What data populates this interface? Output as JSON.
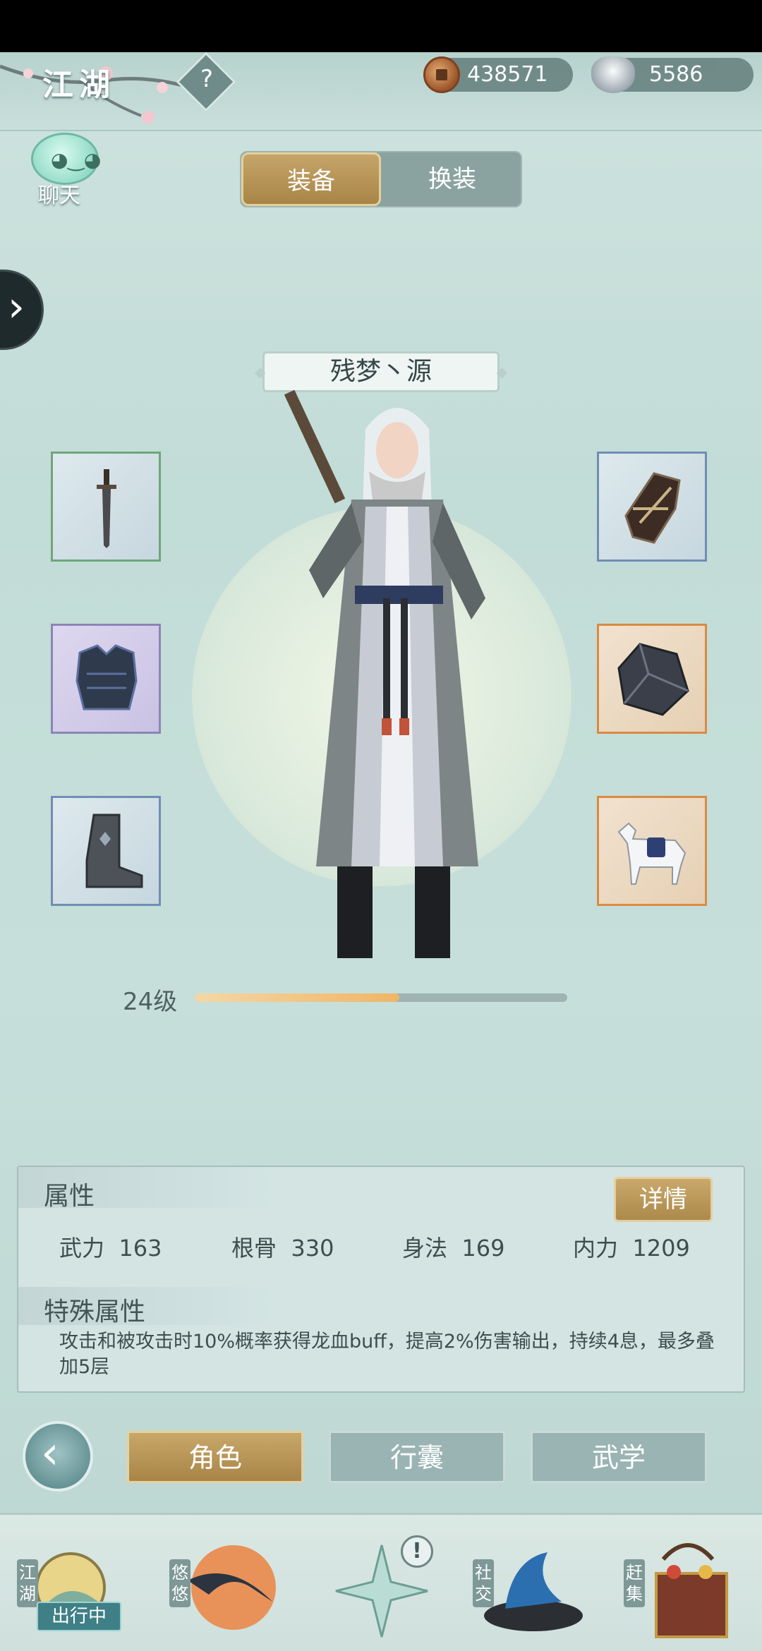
{
  "top_bar": {
    "title": "江湖",
    "coins": "438571",
    "silver": "5586"
  },
  "chat": {
    "label": "聊天"
  },
  "tabs": [
    {
      "label": "装备",
      "active": true
    },
    {
      "label": "换装",
      "active": false
    }
  ],
  "character": {
    "name": "残梦丶源",
    "level_label": "24级",
    "level_progress": 0.55
  },
  "equipment_slots": [
    {
      "slot": "weapon",
      "icon": "sword-icon",
      "rarity_color": "#6ea67a"
    },
    {
      "slot": "armor",
      "icon": "armor-icon",
      "rarity_color": "#8a86b5"
    },
    {
      "slot": "boots",
      "icon": "boot-icon",
      "rarity_color": "#6f8eb4"
    },
    {
      "slot": "bracer",
      "icon": "bracer-icon",
      "rarity_color": "#6f8eb4"
    },
    {
      "slot": "gem",
      "icon": "gem-icon",
      "rarity_color": "#d98b43"
    },
    {
      "slot": "mount",
      "icon": "horse-icon",
      "rarity_color": "#d98b43"
    }
  ],
  "attributes": {
    "title": "属性",
    "detail_button": "详情",
    "stats": [
      {
        "label": "武力",
        "value": "163"
      },
      {
        "label": "根骨",
        "value": "330"
      },
      {
        "label": "身法",
        "value": "169"
      },
      {
        "label": "内力",
        "value": "1209"
      }
    ],
    "special_title": "特殊属性",
    "special_text": "攻击和被攻击时10%概率获得龙血buff，提高2%伤害输出，持续4息，最多叠加5层"
  },
  "nav": {
    "role": "角色",
    "bag": "行囊",
    "martial": "武学"
  },
  "dock": {
    "jianghu": "江湖",
    "outgoing_badge": "出行中",
    "youyou": "悠悠",
    "center_alert": "!",
    "social": "社交",
    "market": "赶集"
  },
  "colors": {
    "accent_gold": "#b8965a",
    "panel_teal": "#9ab4b3"
  }
}
